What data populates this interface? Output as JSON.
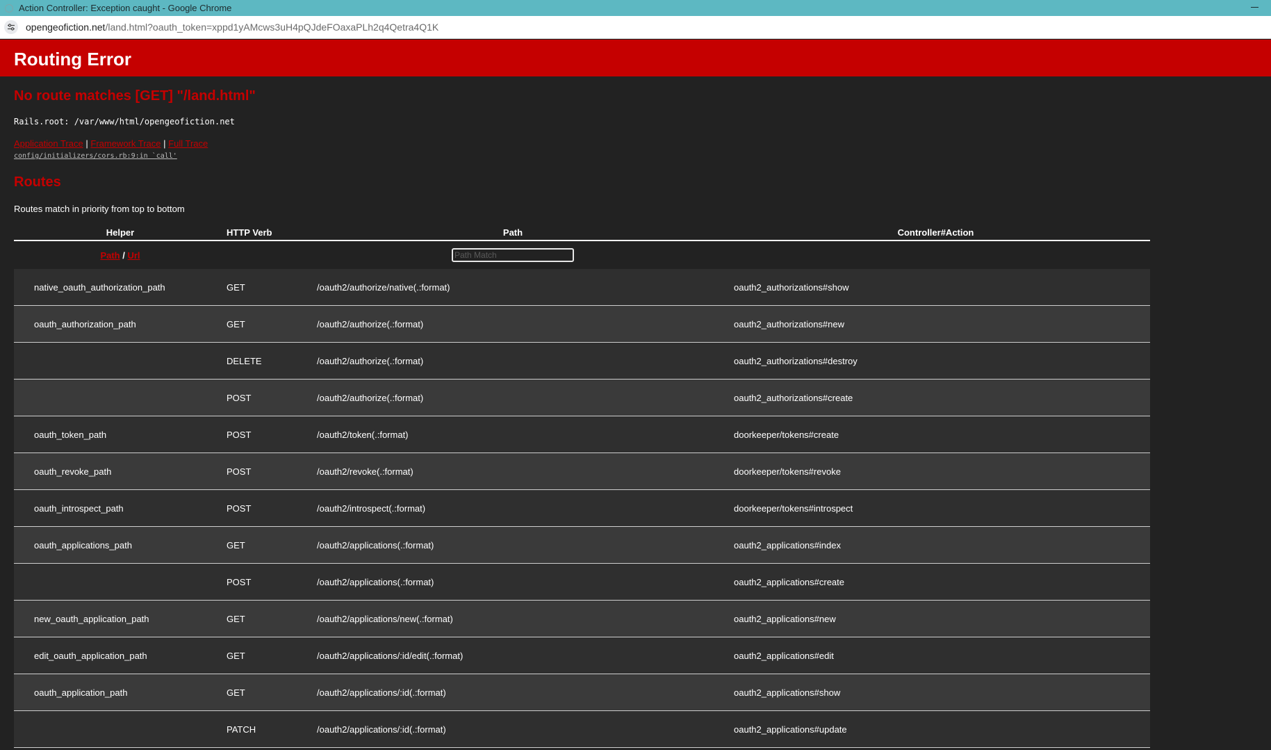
{
  "browser": {
    "window_title": "Action Controller: Exception caught - Google Chrome",
    "url_host": "opengeofiction.net",
    "url_rest": "/land.html?oauth_token=xppd1yAMcws3uH4pQJdeFOaxaPLh2q4Qetra4Q1K"
  },
  "page": {
    "header_title": "Routing Error",
    "error_message": "No route matches [GET] \"/land.html\"",
    "rails_root": "Rails.root: /var/www/html/opengeofiction.net",
    "trace_links": {
      "application": "Application Trace",
      "framework": "Framework Trace",
      "full": "Full Trace",
      "separator": "|"
    },
    "trace_file": "config/initializers/cors.rb:9:in `call'",
    "routes_title": "Routes",
    "routes_note": "Routes match in priority from top to bottom"
  },
  "table": {
    "headers": {
      "helper": "Helper",
      "verb": "HTTP Verb",
      "path": "Path",
      "action": "Controller#Action"
    },
    "filter": {
      "path_link": "Path",
      "slash": "/",
      "url_link": "Url",
      "placeholder": "Path Match"
    },
    "rows": [
      {
        "helper": "native_oauth_authorization_path",
        "verb": "GET",
        "path": "/oauth2/authorize/native(.:format)",
        "action": "oauth2_authorizations#show"
      },
      {
        "helper": "oauth_authorization_path",
        "verb": "GET",
        "path": "/oauth2/authorize(.:format)",
        "action": "oauth2_authorizations#new"
      },
      {
        "helper": "",
        "verb": "DELETE",
        "path": "/oauth2/authorize(.:format)",
        "action": "oauth2_authorizations#destroy"
      },
      {
        "helper": "",
        "verb": "POST",
        "path": "/oauth2/authorize(.:format)",
        "action": "oauth2_authorizations#create"
      },
      {
        "helper": "oauth_token_path",
        "verb": "POST",
        "path": "/oauth2/token(.:format)",
        "action": "doorkeeper/tokens#create"
      },
      {
        "helper": "oauth_revoke_path",
        "verb": "POST",
        "path": "/oauth2/revoke(.:format)",
        "action": "doorkeeper/tokens#revoke"
      },
      {
        "helper": "oauth_introspect_path",
        "verb": "POST",
        "path": "/oauth2/introspect(.:format)",
        "action": "doorkeeper/tokens#introspect"
      },
      {
        "helper": "oauth_applications_path",
        "verb": "GET",
        "path": "/oauth2/applications(.:format)",
        "action": "oauth2_applications#index"
      },
      {
        "helper": "",
        "verb": "POST",
        "path": "/oauth2/applications(.:format)",
        "action": "oauth2_applications#create"
      },
      {
        "helper": "new_oauth_application_path",
        "verb": "GET",
        "path": "/oauth2/applications/new(.:format)",
        "action": "oauth2_applications#new"
      },
      {
        "helper": "edit_oauth_application_path",
        "verb": "GET",
        "path": "/oauth2/applications/:id/edit(.:format)",
        "action": "oauth2_applications#edit"
      },
      {
        "helper": "oauth_application_path",
        "verb": "GET",
        "path": "/oauth2/applications/:id(.:format)",
        "action": "oauth2_applications#show"
      },
      {
        "helper": "",
        "verb": "PATCH",
        "path": "/oauth2/applications/:id(.:format)",
        "action": "oauth2_applications#update"
      }
    ]
  }
}
